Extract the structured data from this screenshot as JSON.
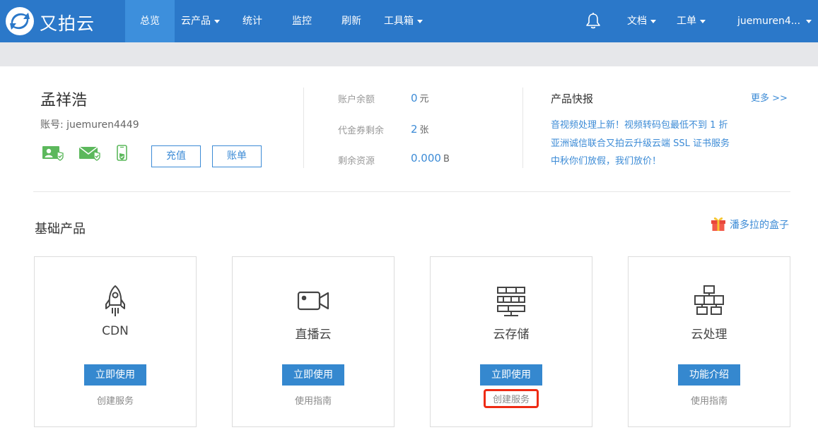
{
  "brand": {
    "name": "又拍云"
  },
  "nav": {
    "items": [
      {
        "label": "总览",
        "active": true,
        "dropdown": false
      },
      {
        "label": "云产品",
        "active": false,
        "dropdown": true
      },
      {
        "label": "统计",
        "active": false,
        "dropdown": false
      },
      {
        "label": "监控",
        "active": false,
        "dropdown": false
      },
      {
        "label": "刷新",
        "active": false,
        "dropdown": false
      },
      {
        "label": "工具箱",
        "active": false,
        "dropdown": true
      }
    ],
    "right": [
      {
        "label": "文档",
        "dropdown": true
      },
      {
        "label": "工单",
        "dropdown": true
      },
      {
        "label": "juemuren4...",
        "dropdown": true
      }
    ]
  },
  "account": {
    "name": "孟祥浩",
    "account_line": "账号: juemuren4449",
    "recharge_label": "充值",
    "bill_label": "账单"
  },
  "stats": [
    {
      "label": "账户余额",
      "value": "0",
      "unit": "元"
    },
    {
      "label": "代金券剩余",
      "value": "2",
      "unit": "张"
    },
    {
      "label": "剩余资源",
      "value": "0.000",
      "unit": "B"
    }
  ],
  "news": {
    "title": "产品快报",
    "more_label": "更多 >>",
    "items": [
      "音视频处理上新！视频转码包最低不到 1 折",
      "亚洲诚信联合又拍云升级云端 SSL 证书服务",
      "中秋你们放假，我们放价！"
    ]
  },
  "products": {
    "section_title": "基础产品",
    "pandora_label": "潘多拉的盒子",
    "cards": [
      {
        "name": "CDN",
        "icon": "rocket-icon",
        "button": "立即使用",
        "link": "创建服务",
        "highlighted": false
      },
      {
        "name": "直播云",
        "icon": "video-camera-icon",
        "button": "立即使用",
        "link": "使用指南",
        "highlighted": false
      },
      {
        "name": "云存储",
        "icon": "server-stack-icon",
        "button": "立即使用",
        "link": "创建服务",
        "highlighted": true
      },
      {
        "name": "云处理",
        "icon": "process-flow-icon",
        "button": "功能介绍",
        "link": "使用指南",
        "highlighted": false
      }
    ]
  },
  "colors": {
    "nav_bg": "#2b78c9",
    "nav_active": "#3d8fdc",
    "accent": "#3588cf",
    "verify_green": "#5cb85c",
    "highlight": "#ee2b14"
  }
}
